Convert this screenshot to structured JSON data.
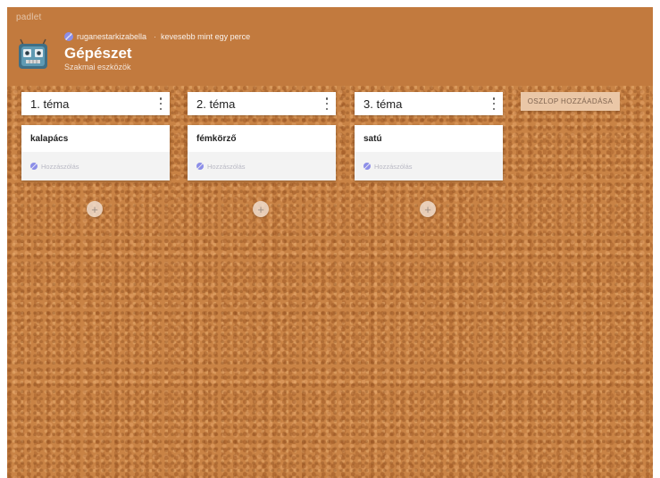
{
  "brand": "padlet",
  "author": {
    "name": "ruganestarkizabella",
    "time": "kevesebb mint egy perce"
  },
  "board": {
    "title": "Gépészet",
    "subtitle": "Szakmai eszközök",
    "add_column_label": "OSZLOP HOZZÁADÁSA"
  },
  "columns": [
    {
      "title": "1. téma",
      "posts": [
        {
          "title": "kalapács",
          "footer": "Hozzászólás"
        }
      ]
    },
    {
      "title": "2. téma",
      "posts": [
        {
          "title": "fémkörző",
          "footer": "Hozzászólás"
        }
      ]
    },
    {
      "title": "3. téma",
      "posts": [
        {
          "title": "satú",
          "footer": "Hozzászólás"
        }
      ]
    }
  ],
  "add_post_symbol": "+",
  "colors": {
    "header": "#c27a3e",
    "board": "#c98345",
    "add_column_button": "#eac7a7"
  },
  "icons": {
    "board_avatar": "robot-icon",
    "user_avatar": "user-avatar-icon",
    "column_menu": "kebab-menu-icon",
    "add_post": "plus-icon"
  }
}
